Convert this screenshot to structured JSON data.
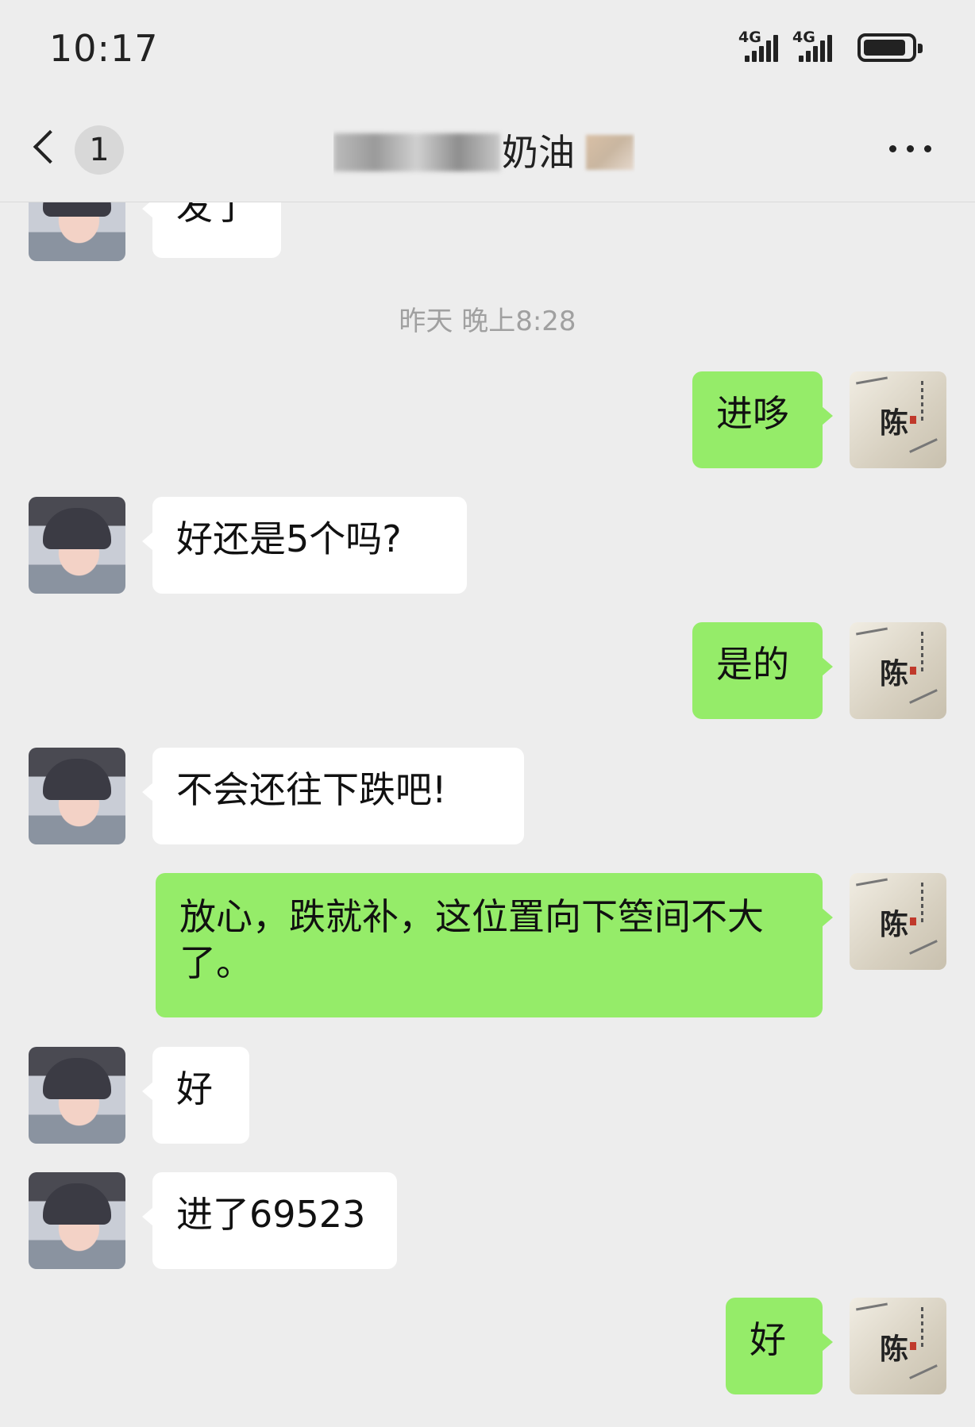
{
  "status_bar": {
    "time": "10:17",
    "signal1_label": "4G",
    "signal2_label": "4G"
  },
  "header": {
    "unread_count": "1",
    "title_visible": "奶油"
  },
  "chat": {
    "timestamp": "昨天 晚上8:28",
    "messages": [
      {
        "from": "her",
        "text": "发了"
      },
      {
        "from": "me",
        "text": "进哆"
      },
      {
        "from": "her",
        "text": "好还是5个吗?"
      },
      {
        "from": "me",
        "text": "是的"
      },
      {
        "from": "her",
        "text": "不会还往下跌吧!"
      },
      {
        "from": "me",
        "text": "放心，跌就补，这位置向下箜间不大了。"
      },
      {
        "from": "her",
        "text": "好"
      },
      {
        "from": "her",
        "text": "进了69523"
      },
      {
        "from": "me",
        "text": "好"
      }
    ],
    "my_avatar_char": "陈"
  },
  "colors": {
    "background": "#ededed",
    "outgoing_bubble": "#95ec69",
    "incoming_bubble": "#ffffff",
    "timestamp_text": "#a0a0a0"
  }
}
